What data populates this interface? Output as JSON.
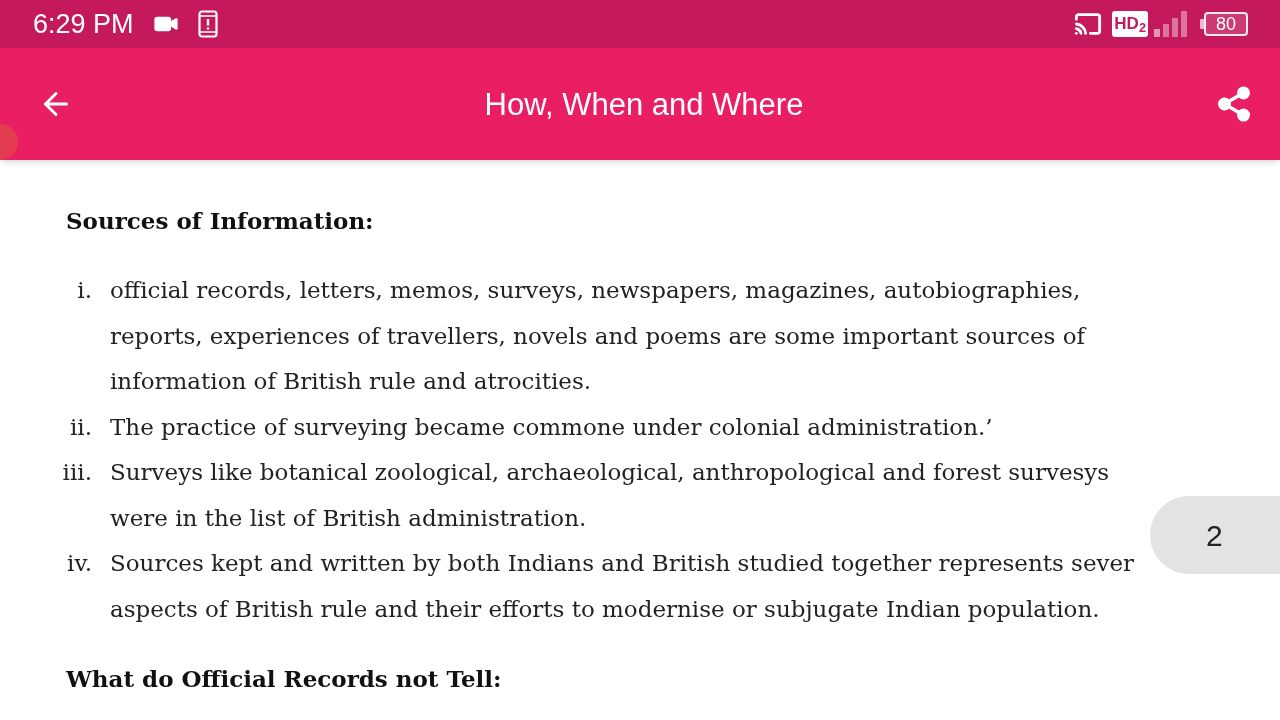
{
  "status_bar": {
    "time": "6:29 PM",
    "hd_indicator": "HD$_{2}$",
    "battery": "80"
  },
  "app_bar": {
    "title": "How, When and Where"
  },
  "content": {
    "sections": [
      {
        "kind": "heading",
        "text": "Sources of Information:"
      },
      {
        "kind": "list",
        "items": [
          {
            "marker": "i.",
            "lines": [
              "official records, letters, memos, surveys, newspapers, magazines, autobiographies,",
              "reports, experiences of travellers, novels and poems are some important sources of",
              "information of British rule and atrocities."
            ]
          },
          {
            "marker": "ii.",
            "lines": [
              "The practice of surveying became commone under colonial administration.’"
            ]
          },
          {
            "marker": "iii.",
            "lines": [
              "Surveys like botanical zoological, archaeological, anthropological and forest survesys",
              "were in the list of British administration."
            ]
          },
          {
            "marker": "iv.",
            "lines": [
              "Sources kept and written by both Indians and British studied together represents sever",
              "aspects of British rule and their efforts to modernise or subjugate Indian population."
            ]
          }
        ]
      },
      {
        "kind": "heading",
        "text": "What do Official Records not Tell:"
      }
    ]
  },
  "page_indicator": "2"
}
